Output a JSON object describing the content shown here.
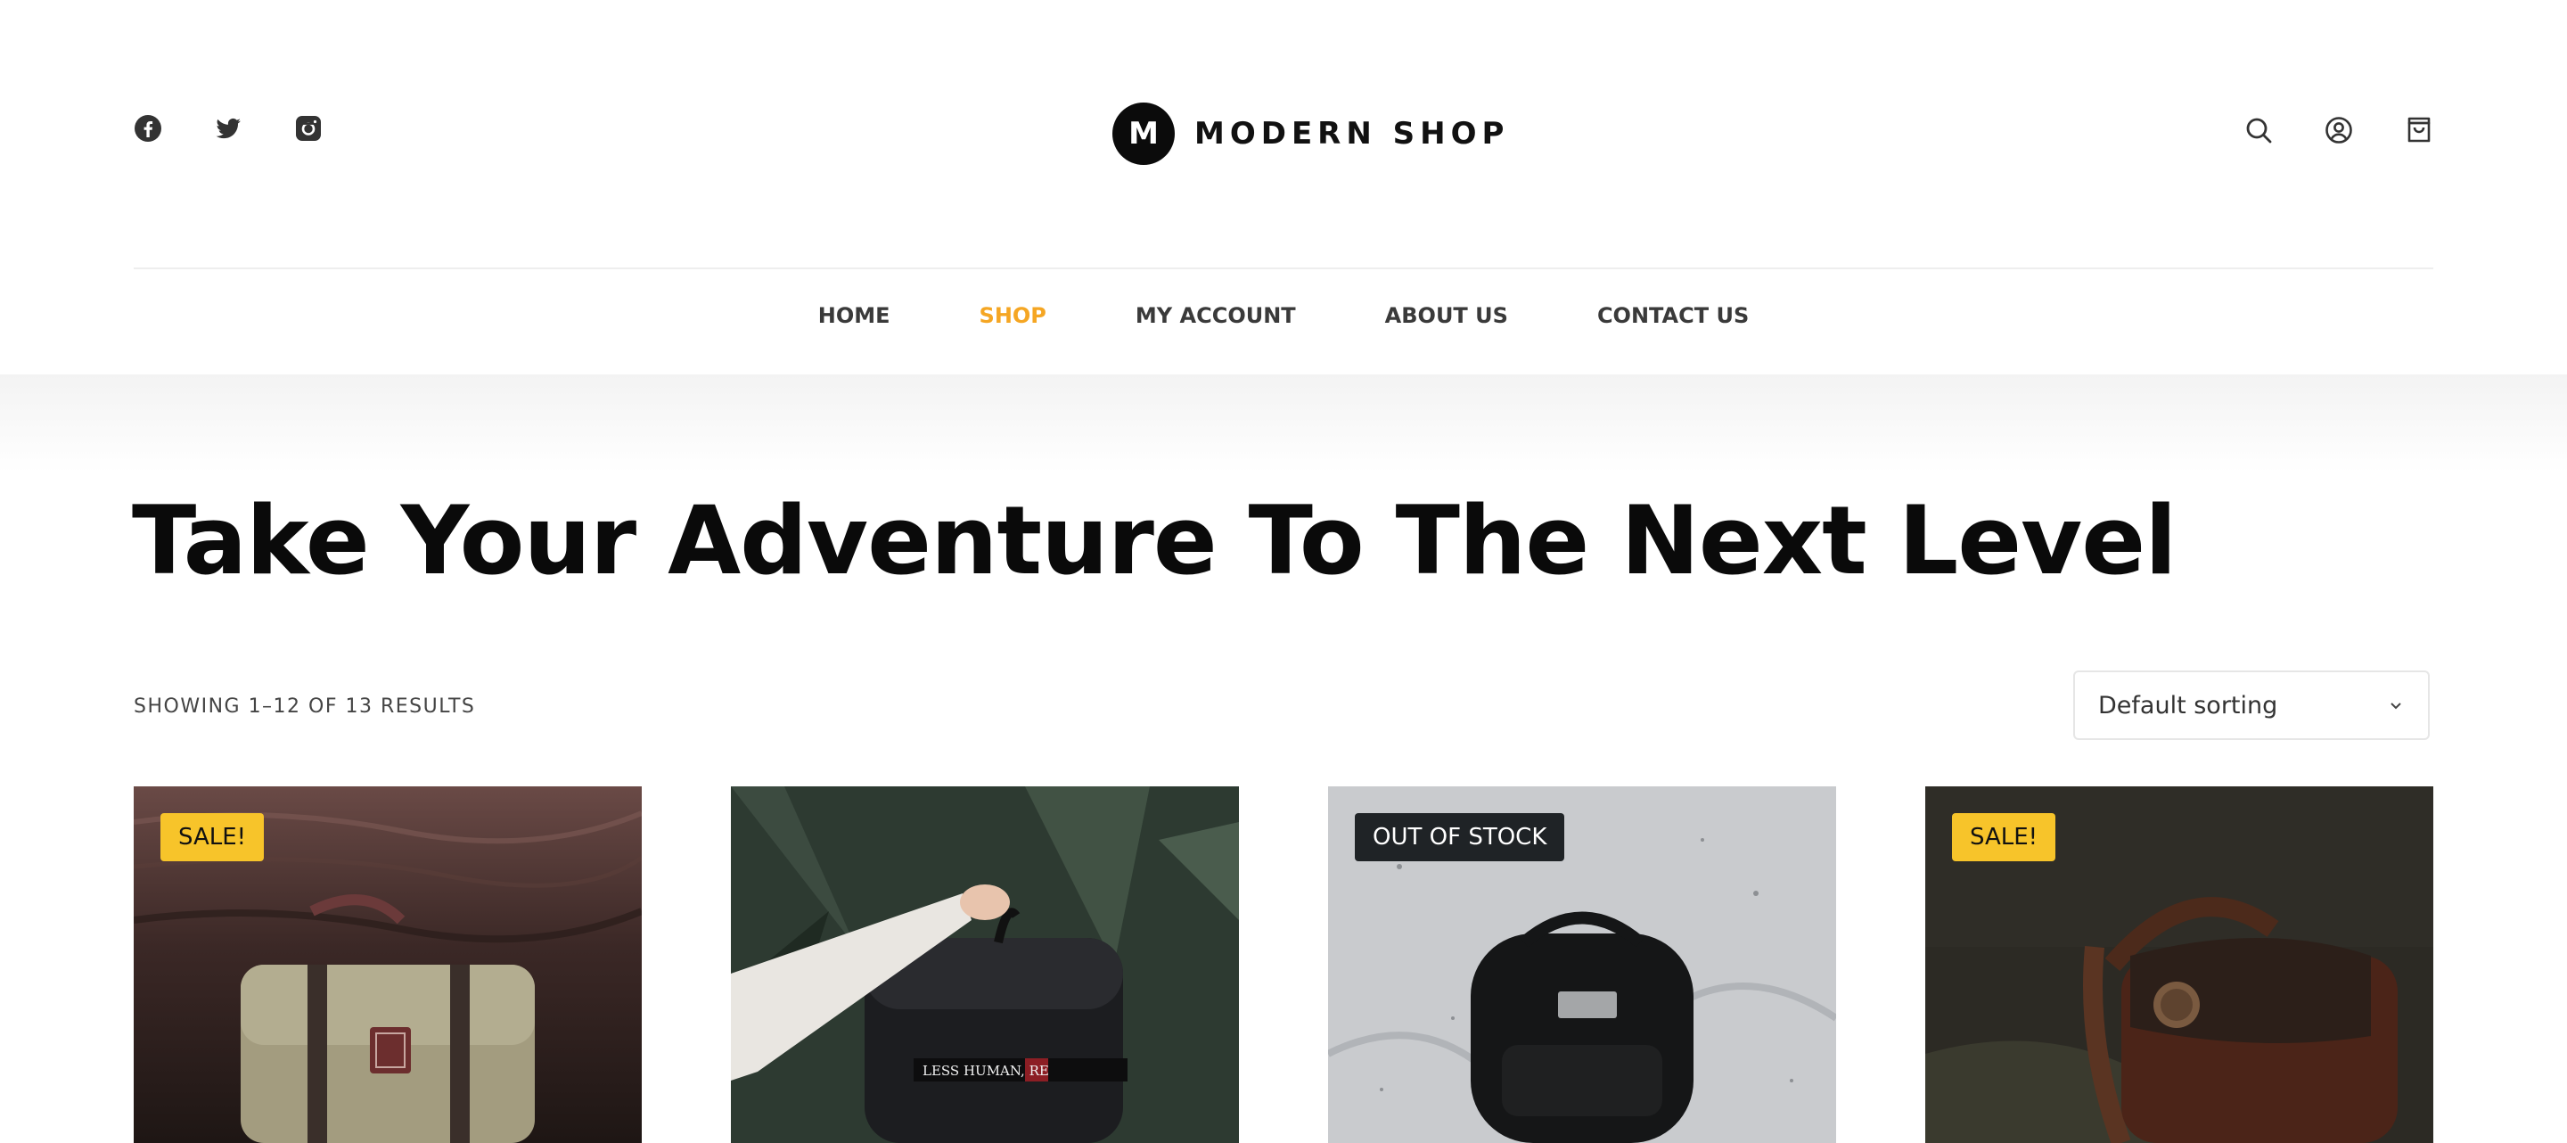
{
  "brand": {
    "initial": "M",
    "name": "MODERN SHOP"
  },
  "social": [
    {
      "icon": "facebook-icon"
    },
    {
      "icon": "twitter-icon"
    },
    {
      "icon": "instagram-icon"
    }
  ],
  "header_actions": [
    {
      "icon": "search-icon"
    },
    {
      "icon": "account-icon"
    },
    {
      "icon": "cart-icon"
    }
  ],
  "nav": {
    "items": [
      {
        "label": "HOME",
        "active": false
      },
      {
        "label": "SHOP",
        "active": true
      },
      {
        "label": "MY ACCOUNT",
        "active": false
      },
      {
        "label": "ABOUT US",
        "active": false
      },
      {
        "label": "CONTACT US",
        "active": false
      }
    ],
    "active_color": "#f5a623"
  },
  "page": {
    "title": "Take Your Adventure To The Next Level",
    "result_count": "SHOWING 1–12 OF 13 RESULTS",
    "sorting": {
      "selected": "Default sorting"
    }
  },
  "products": [
    {
      "badge": "SALE!",
      "badge_type": "sale"
    },
    {
      "badge": "",
      "badge_type": "",
      "print_text": "LESS HUMAN, RE"
    },
    {
      "badge": "OUT OF STOCK",
      "badge_type": "oos"
    },
    {
      "badge": "SALE!",
      "badge_type": "sale"
    }
  ],
  "colors": {
    "sale_badge": "#f7c42a",
    "oos_badge": "#1f2326",
    "accent": "#f5a623"
  }
}
